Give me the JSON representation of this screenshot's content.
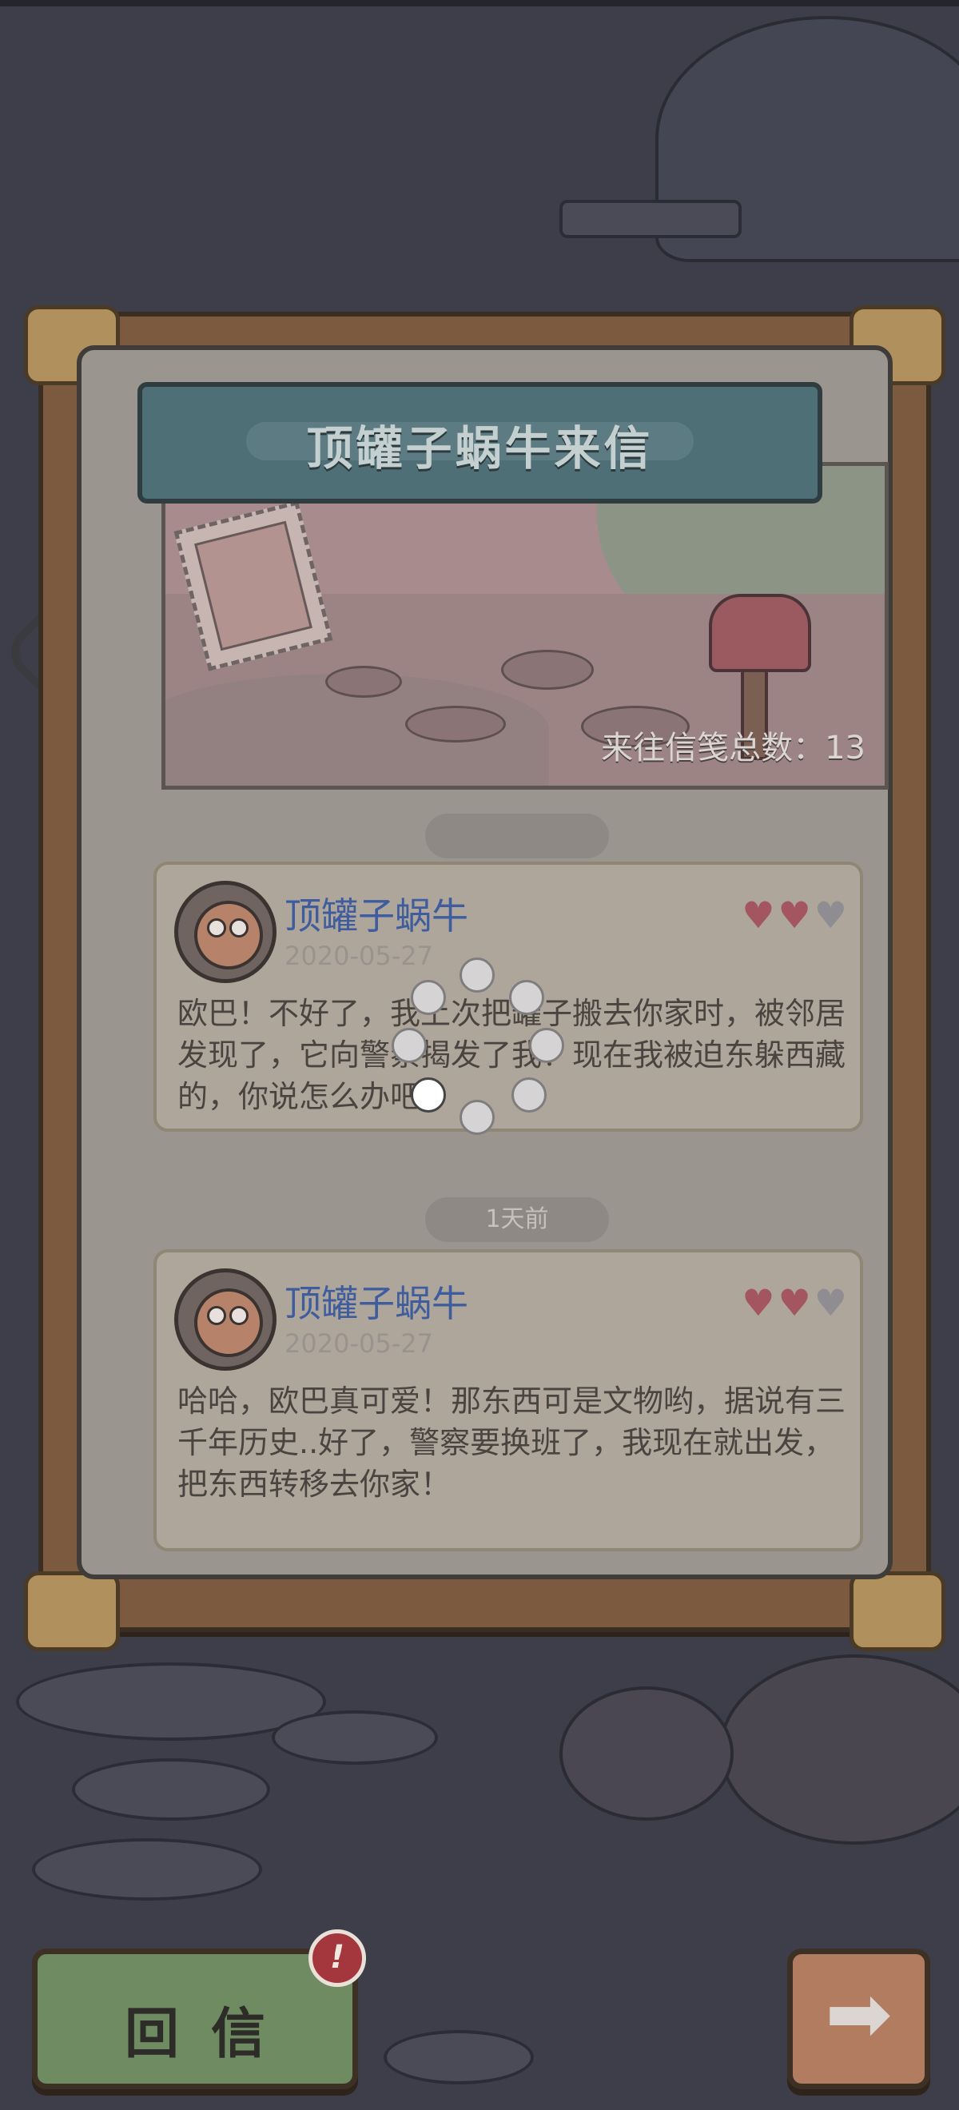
{
  "banner": {
    "title": "顶罐子蜗牛来信",
    "letter_count_label": "来往信笺总数：13"
  },
  "messages": [
    {
      "time_label": "",
      "sender": "顶罐子蜗牛",
      "date": "2020-05-27",
      "hearts_filled": 2,
      "hearts_total": 3,
      "text": "欧巴！不好了，我上次把罐子搬去你家时，被邻居发现了，它向警察揭发了我！现在我被迫东躲西藏的，你说怎么办吧？"
    },
    {
      "time_label": "1天前",
      "sender": "顶罐子蜗牛",
      "date": "2020-05-27",
      "hearts_filled": 2,
      "hearts_total": 3,
      "text": "哈哈，欧巴真可爱！那东西可是文物哟，据说有三千年历史..好了，警察要换班了，我现在就出发，把东西转移去你家！"
    }
  ],
  "buttons": {
    "reply_label": "回信",
    "reply_badge": "!",
    "next_icon": "arrow-right-icon"
  },
  "colors": {
    "heart_filled": "#a3565f",
    "heart_empty": "#8f8d91",
    "sender": "#3f5d9e",
    "overlay_dim": "#3d3e4a"
  }
}
